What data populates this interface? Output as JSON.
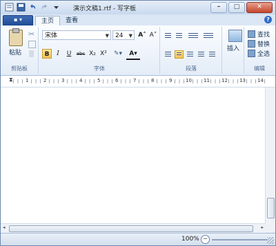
{
  "window": {
    "title": "演示文稿1.rtf - 写字板",
    "minimize_label": "–",
    "maximize_label": "□",
    "close_label": "✕"
  },
  "tabs": [
    {
      "label": "主页"
    },
    {
      "label": "查看"
    }
  ],
  "app_button_label": "▪ ▾",
  "help_label": "?",
  "ribbon": {
    "clipboard": {
      "group_label": "剪贴板",
      "paste_label": "粘贴"
    },
    "font": {
      "group_label": "字体",
      "font_name": "宋体",
      "font_size": "24",
      "grow_label": "A˄",
      "shrink_label": "A˅",
      "bold": "B",
      "italic": "I",
      "underline": "U",
      "strike": "abc",
      "subscript": "X₂",
      "superscript": "X²",
      "highlight_label": "✎▾",
      "color_label": "A▾"
    },
    "paragraph": {
      "group_label": "段落"
    },
    "insert": {
      "group_label": "",
      "insert_label": "插入"
    },
    "editing": {
      "group_label": "编辑",
      "find_label": "查找",
      "replace_label": "替换",
      "select_all_label": "全选"
    }
  },
  "ruler": {
    "numbers": [
      "1",
      "2",
      "3",
      "4",
      "5",
      "6",
      "7",
      "8",
      "9",
      "10",
      "11",
      "12",
      "13",
      "14"
    ]
  },
  "status": {
    "zoom": "100%",
    "zoom_out": "−"
  }
}
